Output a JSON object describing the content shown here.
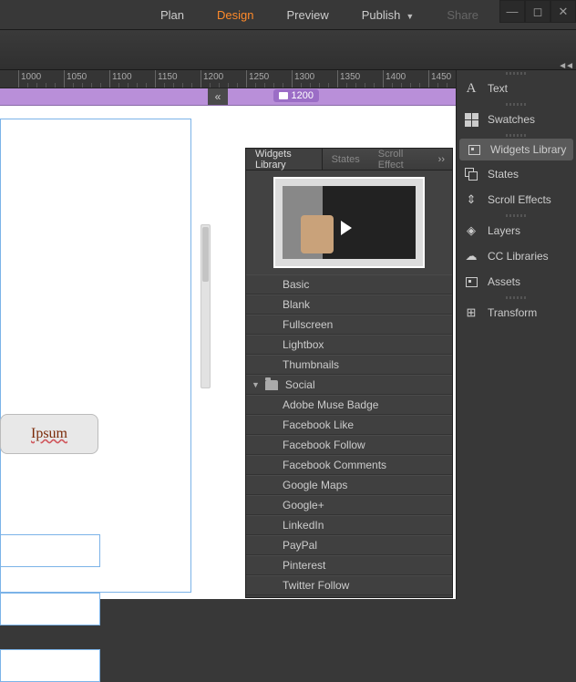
{
  "menu": {
    "plan": "Plan",
    "design": "Design",
    "preview": "Preview",
    "publish": "Publish",
    "share": "Share"
  },
  "ruler": {
    "marks": [
      1000,
      1050,
      1100,
      1150,
      1200,
      1250,
      1300,
      1350,
      1400,
      1450
    ]
  },
  "breakpoint": {
    "value": "1200"
  },
  "canvas": {
    "lorem": "Ipsum"
  },
  "widgets_panel": {
    "tabs": {
      "library": "Widgets Library",
      "states": "States",
      "scroll": "Scroll Effect"
    },
    "items": [
      {
        "type": "leaf",
        "label": "Basic"
      },
      {
        "type": "leaf",
        "label": "Blank"
      },
      {
        "type": "leaf",
        "label": "Fullscreen"
      },
      {
        "type": "leaf",
        "label": "Lightbox"
      },
      {
        "type": "leaf",
        "label": "Thumbnails"
      },
      {
        "type": "folder",
        "label": "Social"
      },
      {
        "type": "leaf",
        "label": "Adobe Muse Badge"
      },
      {
        "type": "leaf",
        "label": "Facebook Like"
      },
      {
        "type": "leaf",
        "label": "Facebook Follow"
      },
      {
        "type": "leaf",
        "label": "Facebook Comments"
      },
      {
        "type": "leaf",
        "label": "Google Maps"
      },
      {
        "type": "leaf",
        "label": "Google+"
      },
      {
        "type": "leaf",
        "label": "LinkedIn"
      },
      {
        "type": "leaf",
        "label": "PayPal"
      },
      {
        "type": "leaf",
        "label": "Pinterest"
      },
      {
        "type": "leaf",
        "label": "Twitter Follow"
      }
    ]
  },
  "dock": {
    "text": "Text",
    "swatches": "Swatches",
    "widgets_library": "Widgets Library",
    "states": "States",
    "scroll_effects": "Scroll Effects",
    "layers": "Layers",
    "cc_libraries": "CC Libraries",
    "assets": "Assets",
    "transform": "Transform"
  }
}
